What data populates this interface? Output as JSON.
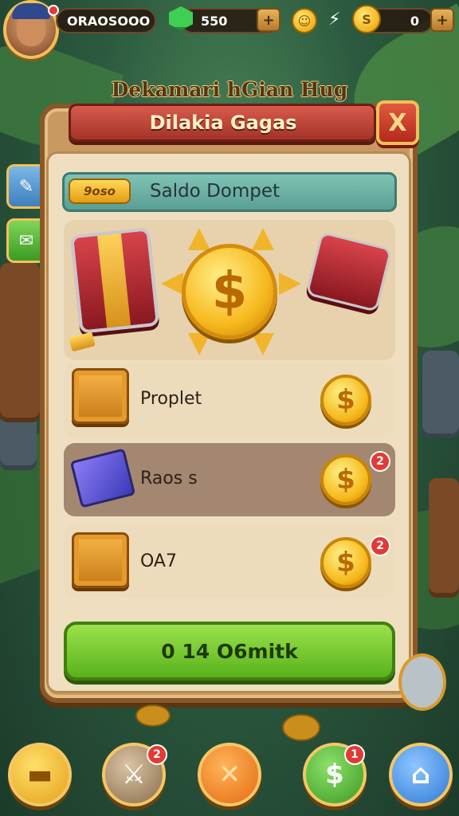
{
  "topbar": {
    "player_name": "ORAOSOOO",
    "gems": "550",
    "gem_add": "+",
    "energy_icon": "lightning-icon",
    "currency_value": "0",
    "currency_add": "+"
  },
  "panel": {
    "header": "Dekamari hGian Hug",
    "title": "Dilakia Gagas",
    "close": "X",
    "wallet_badge": "9oso",
    "wallet_label": "Saldo Dompet"
  },
  "rows": [
    {
      "label": "Proplet",
      "badge": ""
    },
    {
      "label": "Raos s",
      "badge": "2"
    },
    {
      "label": "OA7",
      "badge": "2"
    }
  ],
  "cta": {
    "label": "0 14 O6mitk"
  },
  "bottom_nav": [
    {
      "name": "gold-bar-icon",
      "symbol": "▬",
      "badge": ""
    },
    {
      "name": "sword-icon",
      "symbol": "⚔",
      "badge": "2"
    },
    {
      "name": "battle-icon",
      "symbol": "✕",
      "badge": ""
    },
    {
      "name": "shop-icon",
      "symbol": "$",
      "badge": "1"
    },
    {
      "name": "home-icon",
      "symbol": "⌂",
      "badge": ""
    }
  ],
  "colors": {
    "panel_wood": "#c89a62",
    "banner_red": "#a33428",
    "cta_green": "#58b21c",
    "gold": "#f5b81a"
  }
}
